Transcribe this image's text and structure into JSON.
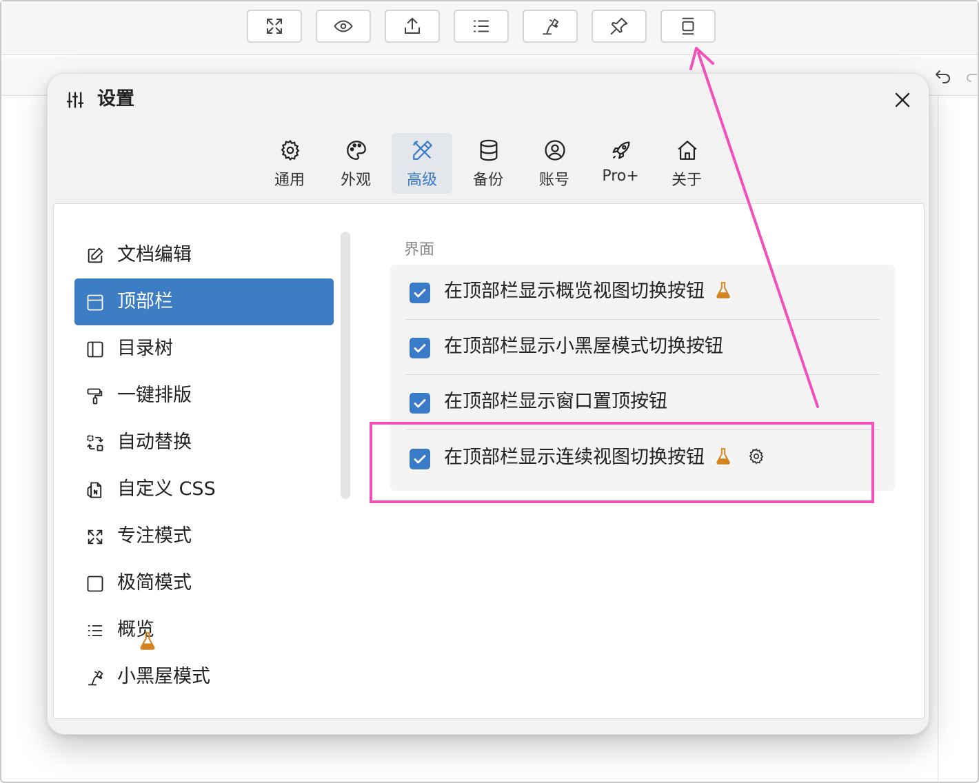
{
  "toolbar": {
    "buttons": [
      {
        "icon": "expand-icon"
      },
      {
        "icon": "eye-icon"
      },
      {
        "icon": "share-icon"
      },
      {
        "icon": "list-icon"
      },
      {
        "icon": "desk-lamp-icon"
      },
      {
        "icon": "pin-icon"
      },
      {
        "icon": "continuous-view-icon"
      }
    ],
    "undo_icon": "undo-icon",
    "redo_icon": "redo-icon"
  },
  "dialog": {
    "title": "设置",
    "title_icon": "sliders-icon",
    "close_icon": "close-icon",
    "tabs": [
      {
        "label": "通用",
        "icon": "gear-icon",
        "active": false
      },
      {
        "label": "外观",
        "icon": "palette-icon",
        "active": false
      },
      {
        "label": "高级",
        "icon": "ruler-pencil-icon",
        "active": true
      },
      {
        "label": "备份",
        "icon": "database-icon",
        "active": false
      },
      {
        "label": "账号",
        "icon": "user-circle-icon",
        "active": false
      },
      {
        "label": "Pro+",
        "icon": "rocket-icon",
        "active": false
      },
      {
        "label": "关于",
        "icon": "home-icon",
        "active": false
      }
    ],
    "sidebar": {
      "items": [
        {
          "label": "文档编辑",
          "icon": "edit-icon",
          "active": false
        },
        {
          "label": "顶部栏",
          "icon": "top-bar-icon",
          "active": true
        },
        {
          "label": "目录树",
          "icon": "sidebar-panel-icon",
          "active": false
        },
        {
          "label": "一键排版",
          "icon": "paint-roller-icon",
          "active": false
        },
        {
          "label": "自动替换",
          "icon": "replace-icon",
          "active": false
        },
        {
          "label": "自定义 CSS",
          "icon": "css-file-icon",
          "active": false
        },
        {
          "label": "专注模式",
          "icon": "expand-icon",
          "active": false
        },
        {
          "label": "极简模式",
          "icon": "square-icon",
          "active": false
        },
        {
          "label": "概览",
          "icon": "list-icon",
          "active": false,
          "badge_icon": "flask-icon"
        },
        {
          "label": "小黑屋模式",
          "icon": "desk-lamp-icon",
          "active": false
        }
      ]
    },
    "section": {
      "title": "界面",
      "options": [
        {
          "label": "在顶部栏显示概览视图切换按钮",
          "checked": true,
          "badge_icon": "flask-icon"
        },
        {
          "label": "在顶部栏显示小黑屋模式切换按钮",
          "checked": true
        },
        {
          "label": "在顶部栏显示窗口置顶按钮",
          "checked": true
        },
        {
          "label": "在顶部栏显示连续视图切换按钮",
          "checked": true,
          "badge_icon": "flask-icon",
          "settings_icon": "gear-icon"
        }
      ]
    }
  },
  "colors": {
    "accent": "#3a7bc8",
    "flask": "#d4831e",
    "annotation": "#f050b8"
  }
}
